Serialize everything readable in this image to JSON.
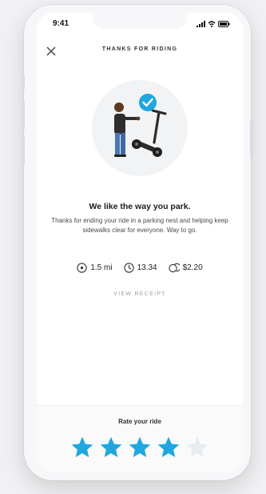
{
  "status_bar": {
    "time": "9:41"
  },
  "header": {
    "title": "THANKS FOR RIDING"
  },
  "message": {
    "headline": "We like the way you park.",
    "body": "Thanks for ending your ride in a parking nest and helping keep sidewalks clear for everyone. Way to go."
  },
  "stats": {
    "distance": "1.5 mi",
    "duration": "13.34",
    "cost": "$2.20"
  },
  "receipt": {
    "label": "VIEW RECEIPT"
  },
  "rating": {
    "label": "Rate your ride",
    "value": 4,
    "max": 5
  },
  "colors": {
    "accent": "#1fa7de",
    "star_inactive": "#e8ecef",
    "text_dark": "#1b1b1b",
    "muted": "#9aa3ab"
  },
  "icons": {
    "close": "close-icon",
    "distance": "location-pin-icon",
    "duration": "clock-icon",
    "cost": "coins-icon",
    "check": "checkmark-icon",
    "star": "star-icon"
  }
}
